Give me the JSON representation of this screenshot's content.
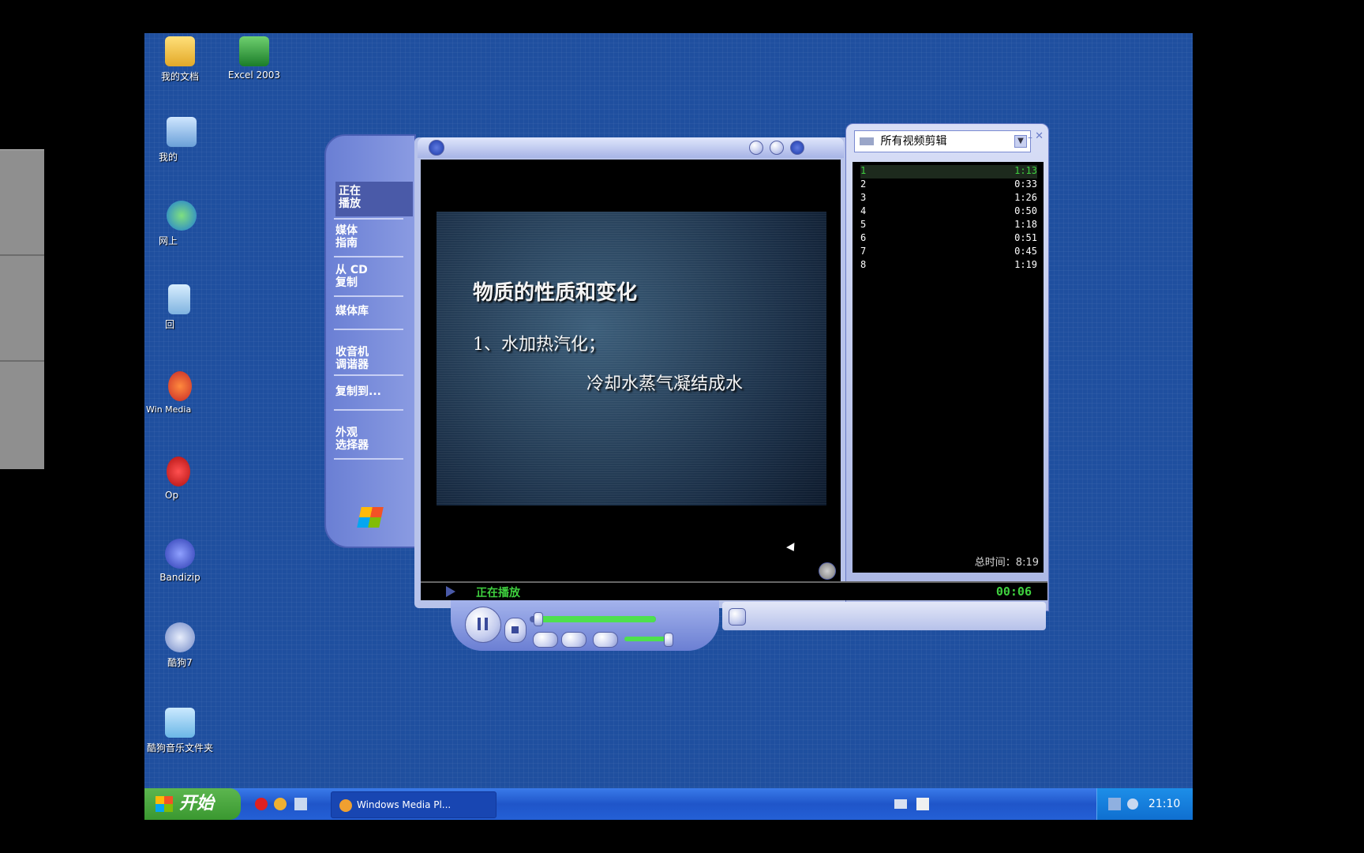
{
  "desktop": {
    "icons": [
      {
        "label": "我的文档",
        "icon": "my-documents-icon"
      },
      {
        "label": "Excel 2003",
        "icon": "excel-icon"
      },
      {
        "label": "我的",
        "icon": "my-computer-icon"
      },
      {
        "label": "网上",
        "icon": "network-icon"
      },
      {
        "label": "回",
        "icon": "recycle-bin-icon"
      },
      {
        "label": "Win Media",
        "icon": "media-player-icon"
      },
      {
        "label": "Op",
        "icon": "opera-icon"
      },
      {
        "label": "Bandizip",
        "icon": "bandizip-icon"
      },
      {
        "label": "酷狗7",
        "icon": "kugou-icon"
      },
      {
        "label": "酷狗音乐文件夹",
        "icon": "kugou-folder-icon"
      }
    ]
  },
  "wmp": {
    "taskpane": {
      "items": [
        {
          "label": "正在\n播放"
        },
        {
          "label": "媒体\n指南"
        },
        {
          "label": "从 CD\n复制"
        },
        {
          "label": "媒体库"
        },
        {
          "label": "收音机\n调谐器"
        },
        {
          "label": "复制到..."
        },
        {
          "label": "外观\n选择器"
        }
      ]
    },
    "video": {
      "title": "物质的性质和变化",
      "line1": "1、水加热汽化；",
      "line2": "冷却水蒸气凝结成水"
    },
    "playlist": {
      "selected": "所有视频剪辑",
      "items": [
        {
          "num": "1",
          "dur": "1:13"
        },
        {
          "num": "2",
          "dur": "0:33"
        },
        {
          "num": "3",
          "dur": "1:26"
        },
        {
          "num": "4",
          "dur": "0:50"
        },
        {
          "num": "5",
          "dur": "1:18"
        },
        {
          "num": "6",
          "dur": "0:51"
        },
        {
          "num": "7",
          "dur": "0:45"
        },
        {
          "num": "8",
          "dur": "1:19"
        }
      ],
      "total_label": "总时间：8:19"
    },
    "status": {
      "text": "正在播放",
      "time": "00:06"
    },
    "seek_progress": 0.06
  },
  "taskbar": {
    "start_label": "开始",
    "task_label": "Windows Media Pl...",
    "clock": "21:10"
  }
}
